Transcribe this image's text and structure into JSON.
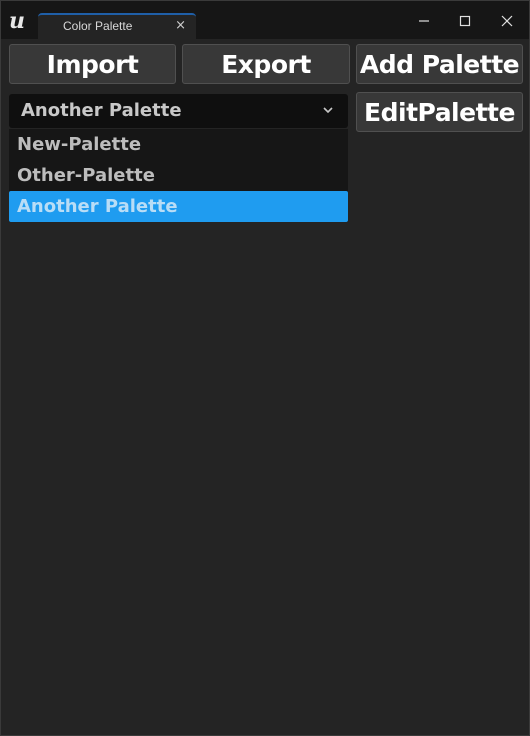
{
  "window": {
    "tab_title": "Color Palette",
    "tab_close": "×",
    "controls": {
      "minimize": "—",
      "maximize": "☐",
      "close": "✕"
    }
  },
  "toolbar": {
    "import_label": "Import",
    "export_label": "Export",
    "add_palette_label": "Add Palette",
    "edit_palette_label": "EditPalette"
  },
  "palette_select": {
    "selected": "Another Palette",
    "options": [
      "New-Palette",
      "Other-Palette",
      "Another Palette"
    ],
    "selected_index": 2
  },
  "colors": {
    "accent": "#1f9cf0",
    "background": "#242424",
    "titlebar": "#161616",
    "button": "#383838"
  }
}
